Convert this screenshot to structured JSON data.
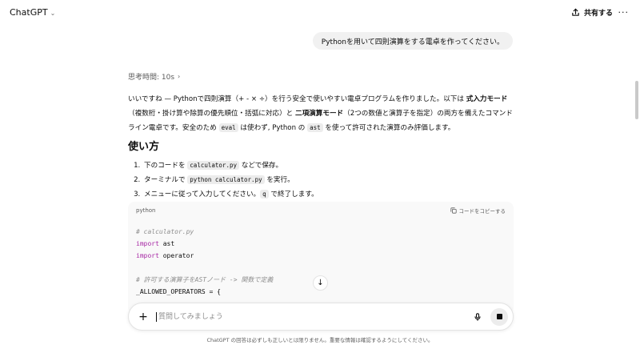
{
  "header": {
    "model_name": "ChatGPT",
    "model_chevron": "⌄",
    "share_label": "共有する",
    "more_label": "···"
  },
  "user_message": "Pythonを用いて四則演算をする電卓を作ってください。",
  "assistant": {
    "thinking_label": "思考時間: 10s",
    "thinking_arrow": "›",
    "intro": {
      "p1": "いいですね — Pythonで四則演算（",
      "p1_ops": "+ - × ÷",
      "p2": "）を行う安全で使いやすい電卓プログラムを作りました。以下は ",
      "b1": "式入力モード",
      "p3": "（複数桁・掛け算や除算の優先順位・括弧に対応）と ",
      "b2": "二項演算モード",
      "p4": "（2つの数値と演算子を指定）の両方を備えたコマンドライン電卓です。安全のため ",
      "code1": "eval",
      "p5": " は使わず, Python の ",
      "code2": "ast",
      "p6": " を使って許可された演算のみ評価します。"
    },
    "usage_heading": "使い方",
    "steps": [
      {
        "pre": "下のコードを ",
        "code": "calculator.py",
        "post": " などで保存。"
      },
      {
        "pre": "ターミナルで ",
        "code": "python calculator.py",
        "post": " を実行。"
      },
      {
        "pre": "メニューに従って入力してください。",
        "code": "q",
        "post": " で終了します。"
      }
    ],
    "code_block": {
      "language": "python",
      "copy_label": "コードをコピーする",
      "lines": {
        "l1": "# calculator.py",
        "l2_kw": "import",
        "l2_rest": " ast",
        "l3_kw": "import",
        "l3_rest": " operator",
        "l5": "# 許可する演算子をASTノード -> 関数で定義",
        "l6": "_ALLOWED_OPERATORS = {"
      }
    }
  },
  "scroll_down_icon": "↓",
  "composer": {
    "plus_label": "+",
    "placeholder": "質問してみましょう"
  },
  "footer_text": "ChatGPT の回答は必ずしも正しいとは限りません。重要な情報は確認するようにしてください。",
  "colors": {
    "user_bubble": "#f1f1f1",
    "code_bg": "#f9f9f9",
    "keyword": "#a626a4",
    "comment": "#8e8e8e"
  }
}
